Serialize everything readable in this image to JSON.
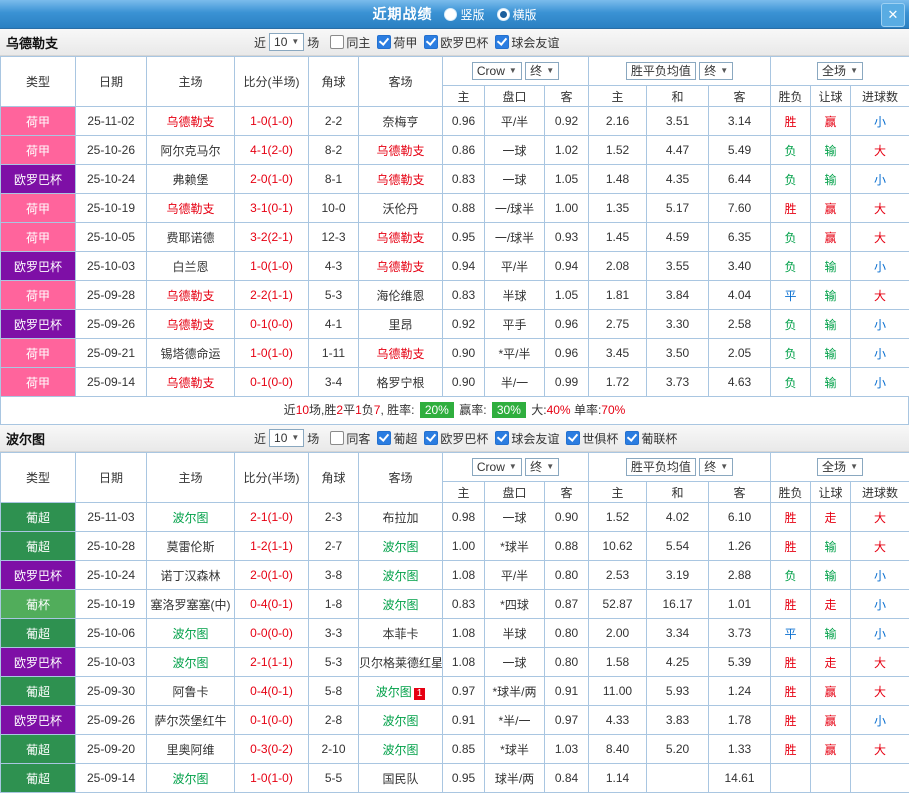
{
  "icons": {
    "arrow_down": "▼",
    "close_glyph": "✕"
  },
  "topbar": {
    "title": "近期战绩",
    "radios": [
      {
        "label": "竖版",
        "state": "off"
      },
      {
        "label": "横版",
        "state": "on"
      }
    ]
  },
  "table_header": {
    "type": "类型",
    "date": "日期",
    "home": "主场",
    "score": "比分(半场)",
    "corner": "角球",
    "away": "客场",
    "odds_source": "Crow",
    "odds_time": "终",
    "avg_label": "胜平负均值",
    "avg_time": "终",
    "scope": "全场",
    "h": "主",
    "pk": "盘口",
    "a": "客",
    "h2": "主",
    "d": "和",
    "a2": "客",
    "wl": "胜负",
    "hcap": "让球",
    "goals": "进球数"
  },
  "sections": [
    {
      "team": "乌德勒支",
      "near_label": "近",
      "count": "10",
      "games_label": "场",
      "filters": [
        {
          "label": "同主",
          "state": "off"
        },
        {
          "label": "荷甲",
          "state": "on"
        },
        {
          "label": "欧罗巴杯",
          "state": "on"
        },
        {
          "label": "球会友谊",
          "state": "on"
        }
      ],
      "rows": [
        {
          "league": "荷甲",
          "lcls": "lea-pink",
          "date": "25-11-02",
          "home": "乌德勒支",
          "hcls": "c-red",
          "score": "1-0(1-0)",
          "corner": "2-2",
          "away": "奈梅亨",
          "acls": "",
          "badge": "",
          "o1": "0.96",
          "pk": "平/半",
          "o2": "0.92",
          "a1": "2.16",
          "a2": "3.51",
          "a3": "3.14",
          "r1": "胜",
          "r1c": "c-red",
          "r2": "赢",
          "r2c": "c-red",
          "r3": "小",
          "r3c": "c-blue"
        },
        {
          "league": "荷甲",
          "lcls": "lea-pink",
          "date": "25-10-26",
          "home": "阿尔克马尔",
          "hcls": "",
          "score": "4-1(2-0)",
          "corner": "8-2",
          "away": "乌德勒支",
          "acls": "c-red",
          "badge": "",
          "o1": "0.86",
          "pk": "一球",
          "o2": "1.02",
          "a1": "1.52",
          "a2": "4.47",
          "a3": "5.49",
          "r1": "负",
          "r1c": "c-green",
          "r2": "输",
          "r2c": "c-green",
          "r3": "大",
          "r3c": "c-red"
        },
        {
          "league": "欧罗巴杯",
          "lcls": "lea-purple",
          "date": "25-10-24",
          "home": "弗赖堡",
          "hcls": "",
          "score": "2-0(1-0)",
          "corner": "8-1",
          "away": "乌德勒支",
          "acls": "c-red",
          "badge": "",
          "o1": "0.83",
          "pk": "一球",
          "o2": "1.05",
          "a1": "1.48",
          "a2": "4.35",
          "a3": "6.44",
          "r1": "负",
          "r1c": "c-green",
          "r2": "输",
          "r2c": "c-green",
          "r3": "小",
          "r3c": "c-blue"
        },
        {
          "league": "荷甲",
          "lcls": "lea-pink",
          "date": "25-10-19",
          "home": "乌德勒支",
          "hcls": "c-red",
          "score": "3-1(0-1)",
          "corner": "10-0",
          "away": "沃伦丹",
          "acls": "",
          "badge": "",
          "o1": "0.88",
          "pk": "一/球半",
          "o2": "1.00",
          "a1": "1.35",
          "a2": "5.17",
          "a3": "7.60",
          "r1": "胜",
          "r1c": "c-red",
          "r2": "赢",
          "r2c": "c-red",
          "r3": "大",
          "r3c": "c-red"
        },
        {
          "league": "荷甲",
          "lcls": "lea-pink",
          "date": "25-10-05",
          "home": "费耶诺德",
          "hcls": "",
          "score": "3-2(2-1)",
          "corner": "12-3",
          "away": "乌德勒支",
          "acls": "c-red",
          "badge": "",
          "o1": "0.95",
          "pk": "一/球半",
          "o2": "0.93",
          "a1": "1.45",
          "a2": "4.59",
          "a3": "6.35",
          "r1": "负",
          "r1c": "c-green",
          "r2": "赢",
          "r2c": "c-red",
          "r3": "大",
          "r3c": "c-red"
        },
        {
          "league": "欧罗巴杯",
          "lcls": "lea-purple",
          "date": "25-10-03",
          "home": "白兰恩",
          "hcls": "",
          "score": "1-0(1-0)",
          "corner": "4-3",
          "away": "乌德勒支",
          "acls": "c-red",
          "badge": "",
          "o1": "0.94",
          "pk": "平/半",
          "o2": "0.94",
          "a1": "2.08",
          "a2": "3.55",
          "a3": "3.40",
          "r1": "负",
          "r1c": "c-green",
          "r2": "输",
          "r2c": "c-green",
          "r3": "小",
          "r3c": "c-blue"
        },
        {
          "league": "荷甲",
          "lcls": "lea-pink",
          "date": "25-09-28",
          "home": "乌德勒支",
          "hcls": "c-red",
          "score": "2-2(1-1)",
          "corner": "5-3",
          "away": "海伦维恩",
          "acls": "",
          "badge": "",
          "o1": "0.83",
          "pk": "半球",
          "o2": "1.05",
          "a1": "1.81",
          "a2": "3.84",
          "a3": "4.04",
          "r1": "平",
          "r1c": "c-blue",
          "r2": "输",
          "r2c": "c-green",
          "r3": "大",
          "r3c": "c-red"
        },
        {
          "league": "欧罗巴杯",
          "lcls": "lea-purple",
          "date": "25-09-26",
          "home": "乌德勒支",
          "hcls": "c-red",
          "score": "0-1(0-0)",
          "corner": "4-1",
          "away": "里昂",
          "acls": "",
          "badge": "",
          "o1": "0.92",
          "pk": "平手",
          "o2": "0.96",
          "a1": "2.75",
          "a2": "3.30",
          "a3": "2.58",
          "r1": "负",
          "r1c": "c-green",
          "r2": "输",
          "r2c": "c-green",
          "r3": "小",
          "r3c": "c-blue"
        },
        {
          "league": "荷甲",
          "lcls": "lea-pink",
          "date": "25-09-21",
          "home": "锡塔德命运",
          "hcls": "",
          "score": "1-0(1-0)",
          "corner": "1-11",
          "away": "乌德勒支",
          "acls": "c-red",
          "badge": "",
          "o1": "0.90",
          "pk": "*平/半",
          "o2": "0.96",
          "a1": "3.45",
          "a2": "3.50",
          "a3": "2.05",
          "r1": "负",
          "r1c": "c-green",
          "r2": "输",
          "r2c": "c-green",
          "r3": "小",
          "r3c": "c-blue"
        },
        {
          "league": "荷甲",
          "lcls": "lea-pink",
          "date": "25-09-14",
          "home": "乌德勒支",
          "hcls": "c-red",
          "score": "0-1(0-0)",
          "corner": "3-4",
          "away": "格罗宁根",
          "acls": "",
          "badge": "",
          "o1": "0.90",
          "pk": "半/一",
          "o2": "0.99",
          "a1": "1.72",
          "a2": "3.73",
          "a3": "4.63",
          "r1": "负",
          "r1c": "c-green",
          "r2": "输",
          "r2c": "c-green",
          "r3": "小",
          "r3c": "c-blue"
        }
      ],
      "summary_parts": [
        {
          "t": "近",
          "c": ""
        },
        {
          "t": "10",
          "c": "c-red"
        },
        {
          "t": "场,胜",
          "c": ""
        },
        {
          "t": "2",
          "c": "c-red"
        },
        {
          "t": "平",
          "c": ""
        },
        {
          "t": "1",
          "c": "c-red"
        },
        {
          "t": "负",
          "c": ""
        },
        {
          "t": "7",
          "c": "c-red"
        },
        {
          "t": ", 胜率: ",
          "c": ""
        },
        {
          "t": "20%",
          "c": "chip"
        },
        {
          "t": " 赢率: ",
          "c": ""
        },
        {
          "t": "30%",
          "c": "chip"
        },
        {
          "t": " 大:",
          "c": ""
        },
        {
          "t": "40%",
          "c": "c-red"
        },
        {
          "t": " 单率:",
          "c": ""
        },
        {
          "t": "70%",
          "c": "c-red"
        }
      ]
    },
    {
      "team": "波尔图",
      "near_label": "近",
      "count": "10",
      "games_label": "场",
      "filters": [
        {
          "label": "同客",
          "state": "off"
        },
        {
          "label": "葡超",
          "state": "on"
        },
        {
          "label": "欧罗巴杯",
          "state": "on"
        },
        {
          "label": "球会友谊",
          "state": "on"
        },
        {
          "label": "世俱杯",
          "state": "on"
        },
        {
          "label": "葡联杯",
          "state": "on"
        }
      ],
      "rows": [
        {
          "league": "葡超",
          "lcls": "lea-green",
          "date": "25-11-03",
          "home": "波尔图",
          "hcls": "c-green",
          "score": "2-1(1-0)",
          "corner": "2-3",
          "away": "布拉加",
          "acls": "",
          "badge": "",
          "o1": "0.98",
          "pk": "一球",
          "o2": "0.90",
          "a1": "1.52",
          "a2": "4.02",
          "a3": "6.10",
          "r1": "胜",
          "r1c": "c-red",
          "r2": "走",
          "r2c": "c-red",
          "r3": "大",
          "r3c": "c-red"
        },
        {
          "league": "葡超",
          "lcls": "lea-green",
          "date": "25-10-28",
          "home": "莫雷伦斯",
          "hcls": "",
          "score": "1-2(1-1)",
          "corner": "2-7",
          "away": "波尔图",
          "acls": "c-green",
          "badge": "",
          "o1": "1.00",
          "pk": "*球半",
          "o2": "0.88",
          "a1": "10.62",
          "a2": "5.54",
          "a3": "1.26",
          "r1": "胜",
          "r1c": "c-red",
          "r2": "输",
          "r2c": "c-green",
          "r3": "大",
          "r3c": "c-red"
        },
        {
          "league": "欧罗巴杯",
          "lcls": "lea-purple",
          "date": "25-10-24",
          "home": "诺丁汉森林",
          "hcls": "",
          "score": "2-0(1-0)",
          "corner": "3-8",
          "away": "波尔图",
          "acls": "c-green",
          "badge": "",
          "o1": "1.08",
          "pk": "平/半",
          "o2": "0.80",
          "a1": "2.53",
          "a2": "3.19",
          "a3": "2.88",
          "r1": "负",
          "r1c": "c-green",
          "r2": "输",
          "r2c": "c-green",
          "r3": "小",
          "r3c": "c-blue"
        },
        {
          "league": "葡杯",
          "lcls": "lea-cup",
          "date": "25-10-19",
          "home": "塞洛罗塞塞(中)",
          "hcls": "",
          "score": "0-4(0-1)",
          "corner": "1-8",
          "away": "波尔图",
          "acls": "c-green",
          "badge": "",
          "o1": "0.83",
          "pk": "*四球",
          "o2": "0.87",
          "a1": "52.87",
          "a2": "16.17",
          "a3": "1.01",
          "r1": "胜",
          "r1c": "c-red",
          "r2": "走",
          "r2c": "c-red",
          "r3": "小",
          "r3c": "c-blue"
        },
        {
          "league": "葡超",
          "lcls": "lea-green",
          "date": "25-10-06",
          "home": "波尔图",
          "hcls": "c-green",
          "score": "0-0(0-0)",
          "corner": "3-3",
          "away": "本菲卡",
          "acls": "",
          "badge": "",
          "o1": "1.08",
          "pk": "半球",
          "o2": "0.80",
          "a1": "2.00",
          "a2": "3.34",
          "a3": "3.73",
          "r1": "平",
          "r1c": "c-blue",
          "r2": "输",
          "r2c": "c-green",
          "r3": "小",
          "r3c": "c-blue"
        },
        {
          "league": "欧罗巴杯",
          "lcls": "lea-purple",
          "date": "25-10-03",
          "home": "波尔图",
          "hcls": "c-green",
          "score": "2-1(1-1)",
          "corner": "5-3",
          "away": "贝尔格莱德红星",
          "acls": "",
          "badge": "",
          "o1": "1.08",
          "pk": "一球",
          "o2": "0.80",
          "a1": "1.58",
          "a2": "4.25",
          "a3": "5.39",
          "r1": "胜",
          "r1c": "c-red",
          "r2": "走",
          "r2c": "c-red",
          "r3": "大",
          "r3c": "c-red"
        },
        {
          "league": "葡超",
          "lcls": "lea-green",
          "date": "25-09-30",
          "home": "阿鲁卡",
          "hcls": "",
          "score": "0-4(0-1)",
          "corner": "5-8",
          "away": "波尔图",
          "acls": "c-green",
          "badge": "1",
          "o1": "0.97",
          "pk": "*球半/两",
          "o2": "0.91",
          "a1": "11.00",
          "a2": "5.93",
          "a3": "1.24",
          "r1": "胜",
          "r1c": "c-red",
          "r2": "赢",
          "r2c": "c-red",
          "r3": "大",
          "r3c": "c-red"
        },
        {
          "league": "欧罗巴杯",
          "lcls": "lea-purple",
          "date": "25-09-26",
          "home": "萨尔茨堡红牛",
          "hcls": "",
          "score": "0-1(0-0)",
          "corner": "2-8",
          "away": "波尔图",
          "acls": "c-green",
          "badge": "",
          "o1": "0.91",
          "pk": "*半/一",
          "o2": "0.97",
          "a1": "4.33",
          "a2": "3.83",
          "a3": "1.78",
          "r1": "胜",
          "r1c": "c-red",
          "r2": "赢",
          "r2c": "c-red",
          "r3": "小",
          "r3c": "c-blue"
        },
        {
          "league": "葡超",
          "lcls": "lea-green",
          "date": "25-09-20",
          "home": "里奥阿维",
          "hcls": "",
          "score": "0-3(0-2)",
          "corner": "2-10",
          "away": "波尔图",
          "acls": "c-green",
          "badge": "",
          "o1": "0.85",
          "pk": "*球半",
          "o2": "1.03",
          "a1": "8.40",
          "a2": "5.20",
          "a3": "1.33",
          "r1": "胜",
          "r1c": "c-red",
          "r2": "赢",
          "r2c": "c-red",
          "r3": "大",
          "r3c": "c-red"
        },
        {
          "league": "葡超",
          "lcls": "lea-green",
          "date": "25-09-14",
          "home": "波尔图",
          "hcls": "c-green",
          "score": "1-0(1-0)",
          "corner": "5-5",
          "away": "国民队",
          "acls": "",
          "badge": "",
          "o1": "0.95",
          "pk": "球半/两",
          "o2": "0.84",
          "a1": "1.14",
          "a2": "",
          "a3": "14.61",
          "r1": "",
          "r1c": "",
          "r2": "",
          "r2c": "",
          "r3": "",
          "r3c": ""
        }
      ]
    }
  ]
}
